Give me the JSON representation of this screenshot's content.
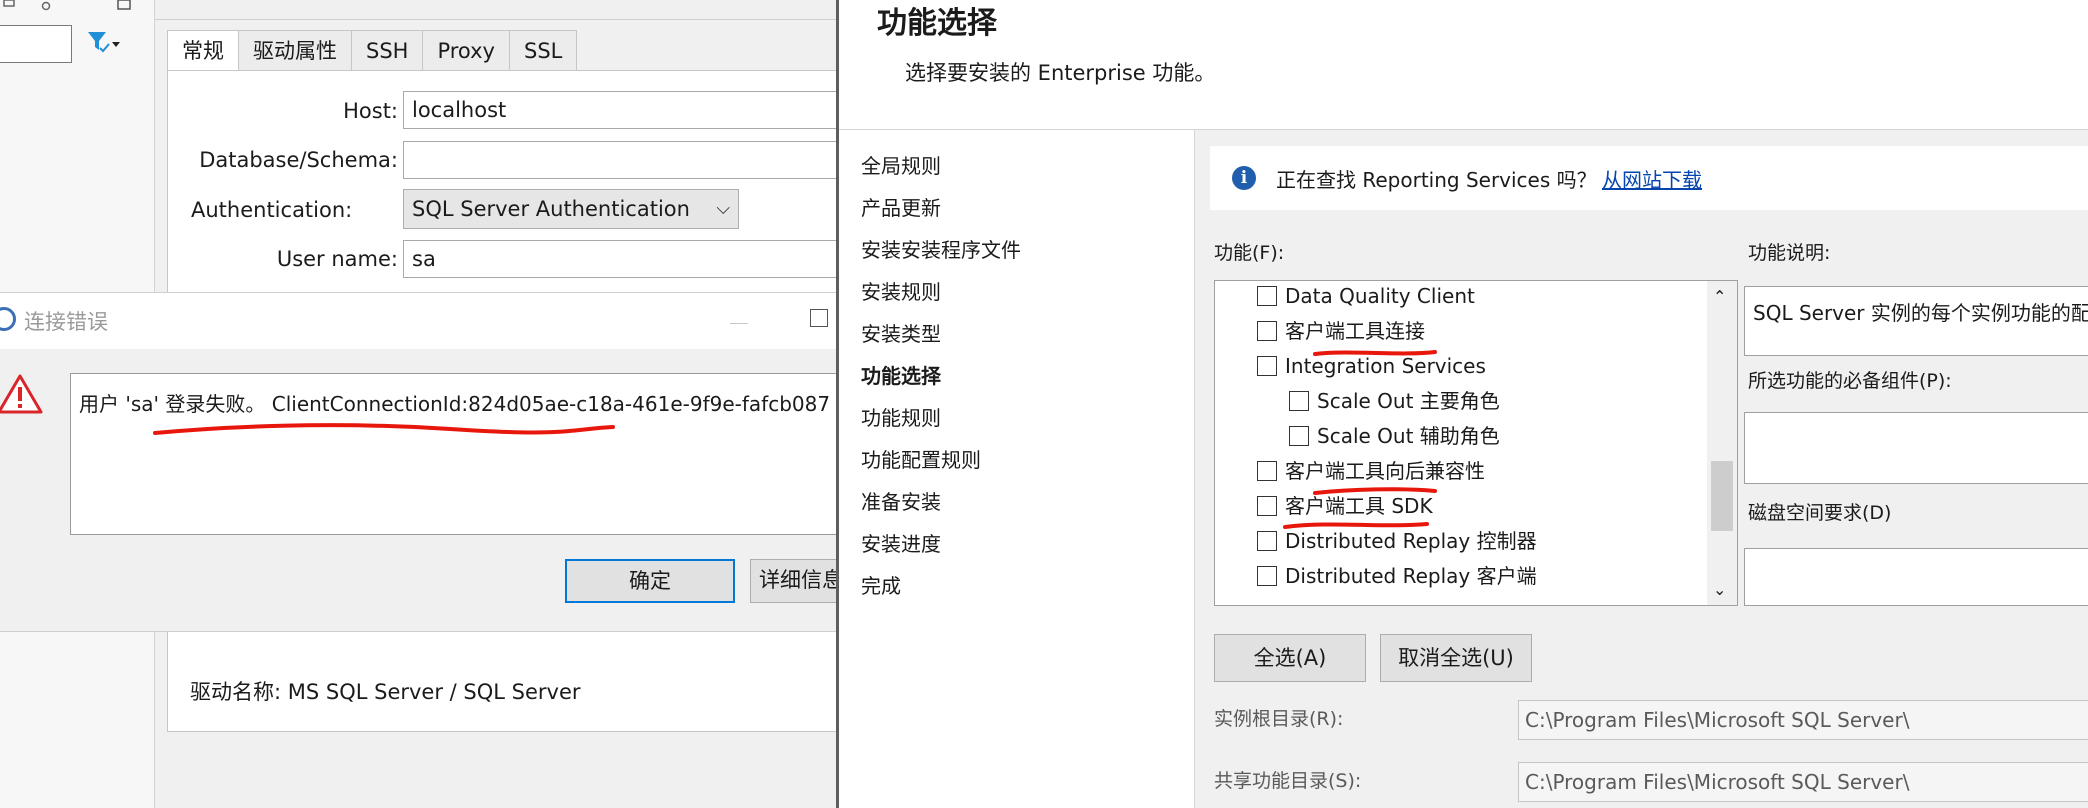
{
  "connection_settings": {
    "tabs": [
      "常规",
      "驱动属性",
      "SSH",
      "Proxy",
      "SSL"
    ],
    "host_label": "Host:",
    "host_value": "localhost",
    "database_label": "Database/Schema:",
    "database_value": "",
    "auth_label": "Authentication:",
    "auth_value": "SQL Server Authentication",
    "username_label": "User name:",
    "username_value": "sa",
    "driver_label": "驱动名称:",
    "driver_value": "MS SQL Server / SQL Server"
  },
  "error_dialog": {
    "title": "连接错误",
    "message": "用户 'sa' 登录失败。 ClientConnectionId:824d05ae-c18a-461e-9f9e-fafcb087",
    "ok_button": "确定",
    "details_button": "详细信息"
  },
  "setup": {
    "title": "功能选择",
    "subtitle": "选择要安装的 Enterprise 功能。",
    "steps": [
      "全局规则",
      "产品更新",
      "安装安装程序文件",
      "安装规则",
      "安装类型",
      "功能选择",
      "功能规则",
      "功能配置规则",
      "准备安装",
      "安装进度",
      "完成"
    ],
    "current_step": "功能选择",
    "info_text": "正在查找 Reporting Services 吗？",
    "info_link": "从网站下载",
    "features_label": "功能(F):",
    "description_label": "功能说明:",
    "features": [
      {
        "label": "Data Quality Client",
        "indent": 0,
        "checked": false
      },
      {
        "label": "客户端工具连接",
        "indent": 0,
        "checked": false
      },
      {
        "label": "Integration Services",
        "indent": 0,
        "checked": false
      },
      {
        "label": "Scale Out 主要角色",
        "indent": 1,
        "checked": false
      },
      {
        "label": "Scale Out 辅助角色",
        "indent": 1,
        "checked": false
      },
      {
        "label": "客户端工具向后兼容性",
        "indent": 0,
        "checked": false
      },
      {
        "label": "客户端工具 SDK",
        "indent": 0,
        "checked": false
      },
      {
        "label": "Distributed Replay 控制器",
        "indent": 0,
        "checked": false
      },
      {
        "label": "Distributed Replay 客户端",
        "indent": 0,
        "checked": false
      }
    ],
    "description_text": "SQL Server 实例的每个实例功能的配",
    "prereq_label": "所选功能的必备组件(P):",
    "disk_label": "磁盘空间要求(D)",
    "select_all": "全选(A)",
    "unselect_all": "取消全选(U)",
    "instance_root_label": "实例根目录(R):",
    "instance_root_value": "C:\\Program Files\\Microsoft SQL Server\\",
    "shared_dir_label": "共享功能目录(S):",
    "shared_dir_value": "C:\\Program Files\\Microsoft SQL Server\\"
  },
  "colors": {
    "annotation_red": "#e8170c",
    "link_blue": "#0645ad",
    "info_blue": "#1f5fae",
    "focus_blue": "#0078d7"
  }
}
